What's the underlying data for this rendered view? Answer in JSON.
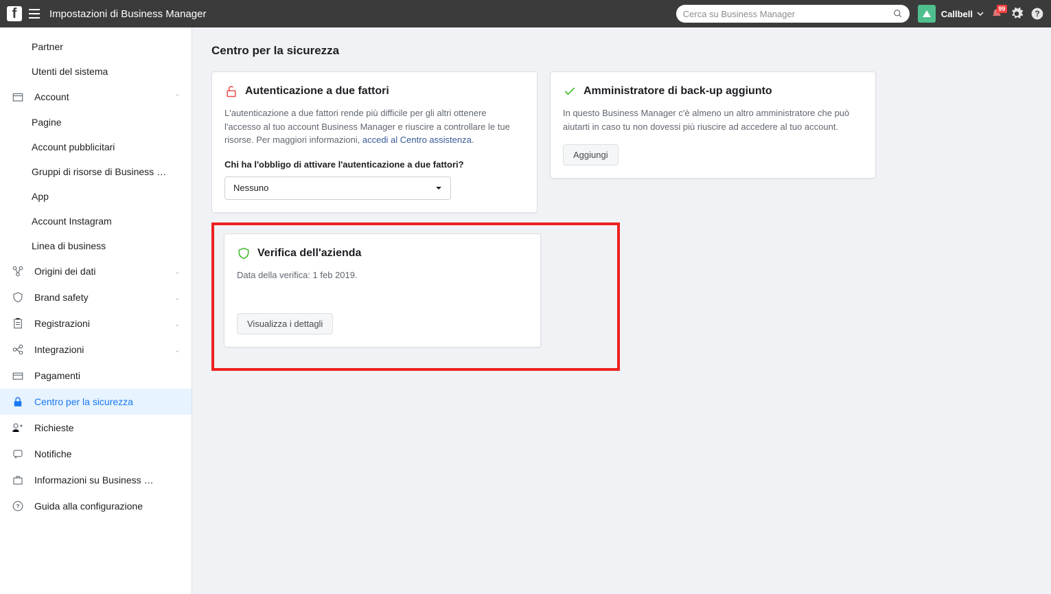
{
  "header": {
    "title": "Impostazioni di Business Manager",
    "search_placeholder": "Cerca su Business Manager",
    "business_name": "Callbell",
    "notif_count": "99"
  },
  "sidebar": {
    "items": [
      {
        "label": "Partner",
        "type": "sub"
      },
      {
        "label": "Utenti del sistema",
        "type": "sub"
      },
      {
        "label": "Account",
        "type": "section",
        "expanded": true
      },
      {
        "label": "Pagine",
        "type": "sub"
      },
      {
        "label": "Account pubblicitari",
        "type": "sub"
      },
      {
        "label": "Gruppi di risorse di Business …",
        "type": "sub"
      },
      {
        "label": "App",
        "type": "sub"
      },
      {
        "label": "Account Instagram",
        "type": "sub"
      },
      {
        "label": "Linea di business",
        "type": "sub"
      },
      {
        "label": "Origini dei dati",
        "type": "section"
      },
      {
        "label": "Brand safety",
        "type": "section"
      },
      {
        "label": "Registrazioni",
        "type": "section"
      },
      {
        "label": "Integrazioni",
        "type": "section"
      },
      {
        "label": "Pagamenti",
        "type": "item"
      },
      {
        "label": "Centro per la sicurezza",
        "type": "item",
        "selected": true
      },
      {
        "label": "Richieste",
        "type": "item"
      },
      {
        "label": "Notifiche",
        "type": "item"
      },
      {
        "label": "Informazioni su Business …",
        "type": "item"
      },
      {
        "label": "Guida alla configurazione",
        "type": "item"
      }
    ]
  },
  "page": {
    "title": "Centro per la sicurezza",
    "two_factor": {
      "title": "Autenticazione a due fattori",
      "text_1": "L'autenticazione a due fattori rende più difficile per gli altri ottenere l'accesso al tuo account Business Manager e riuscire a controllare le tue risorse. Per maggiori informazioni, ",
      "link": "accedi al Centro assistenza",
      "text_2": ".",
      "subhead": "Chi ha l'obbligo di attivare l'autenticazione a due fattori?",
      "select_value": "Nessuno"
    },
    "admin_backup": {
      "title": "Amministratore di back-up aggiunto",
      "text": "In questo Business Manager c'è almeno un altro amministratore che può aiutarti in caso tu non dovessi più riuscire ad accedere al tuo account.",
      "button": "Aggiungi"
    },
    "verification": {
      "title": "Verifica dell'azienda",
      "text": "Data della verifica: 1 feb 2019.",
      "button": "Visualizza i dettagli"
    }
  }
}
